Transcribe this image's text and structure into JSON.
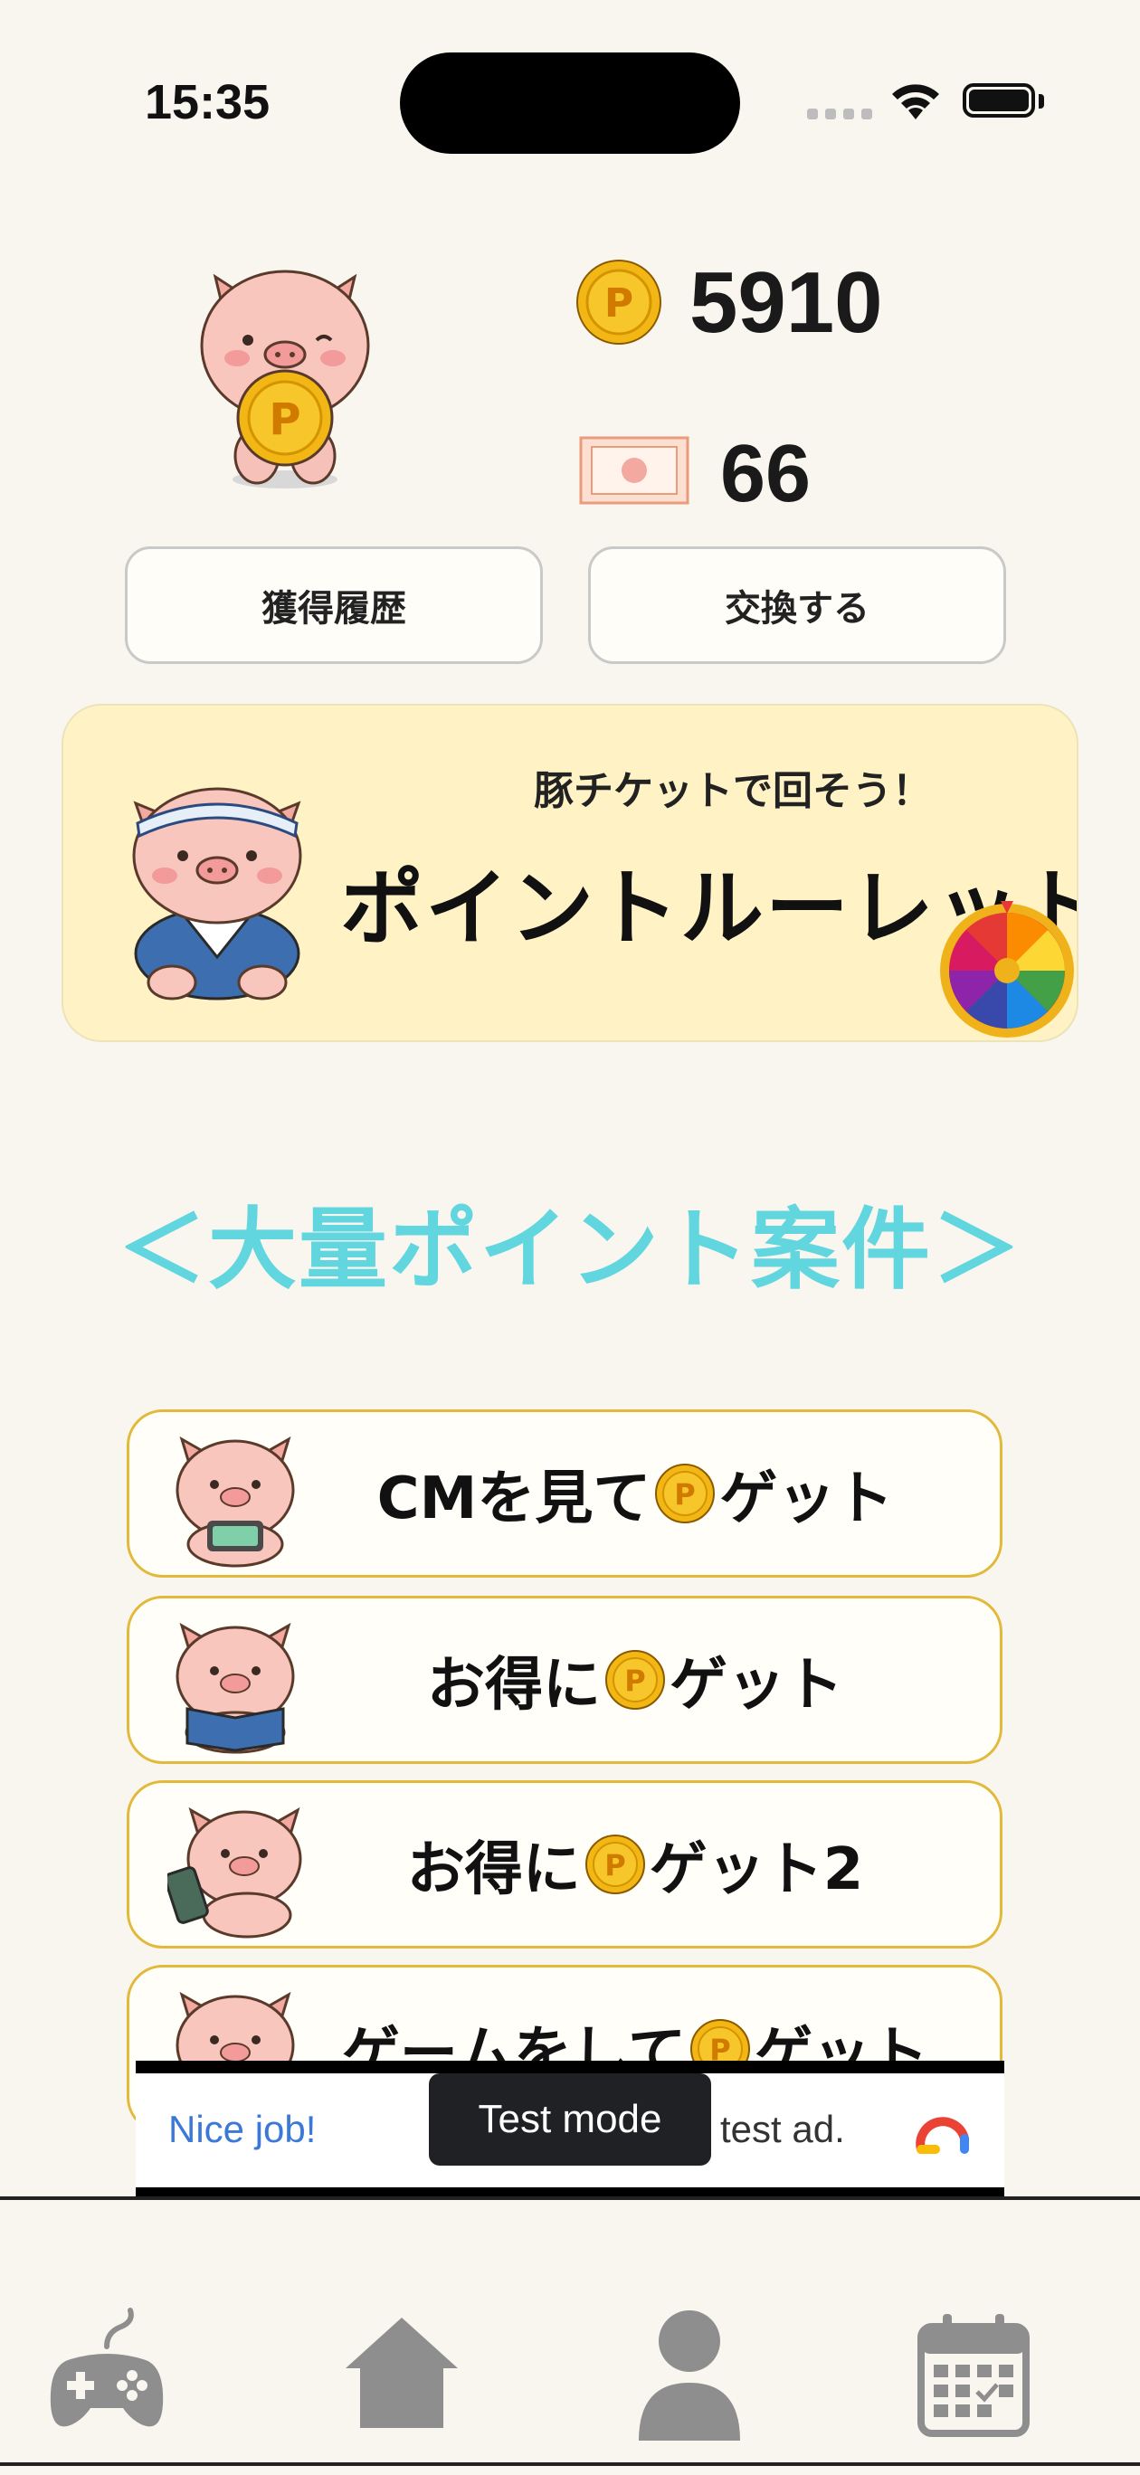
{
  "status_bar": {
    "time": "15:35"
  },
  "balance": {
    "points": "5910",
    "tickets": "66",
    "coin_color": "#f3b715",
    "coin_letter": "P"
  },
  "actions": {
    "history_label": "獲得履歴",
    "exchange_label": "交換する"
  },
  "roulette": {
    "subtitle": "豚チケットで回そう！",
    "title": "ポイントルーレット"
  },
  "campaign_heading": "＜大量ポイント案件＞",
  "list_items": [
    {
      "prefix": "CMを見て",
      "suffix": "ゲット"
    },
    {
      "prefix": "お得に",
      "suffix": "ゲット"
    },
    {
      "prefix": "お得に",
      "suffix": "ゲット2"
    },
    {
      "prefix": "ゲームをして",
      "suffix": "ゲット"
    }
  ],
  "ad": {
    "left_text": "Nice job!",
    "right_text": "test ad.",
    "toast": "Test mode"
  },
  "tabbar": {
    "icons": [
      "gamepad-icon",
      "home-icon",
      "person-icon",
      "calendar-icon"
    ],
    "icon_color": "#8e8e8e"
  },
  "colors": {
    "background": "#f9f6ef",
    "banner": "#fff3c6",
    "heading": "#62d6df",
    "list_border": "#e3b93b"
  }
}
